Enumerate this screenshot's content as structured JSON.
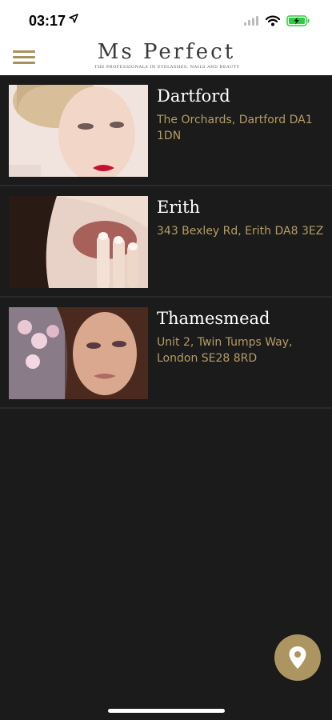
{
  "status": {
    "time": "03:17"
  },
  "header": {
    "logo": "Ms Perfect",
    "tagline": "THE PROFESSIONALS IN EYELASHES, NAILS AND BEAUTY"
  },
  "locations": [
    {
      "name": "Dartford",
      "address": "The Orchards, Dartford DA1 1DN"
    },
    {
      "name": "Erith",
      "address": "343 Bexley Rd, Erith DA8 3EZ"
    },
    {
      "name": "Thamesmead",
      "address": "Unit 2, Twin Tumps Way, London SE28 8RD"
    }
  ],
  "colors": {
    "accent": "#ad9561",
    "background": "#1b1b1b"
  },
  "icons": {
    "menu": "hamburger-icon",
    "fab": "map-pin-icon"
  }
}
